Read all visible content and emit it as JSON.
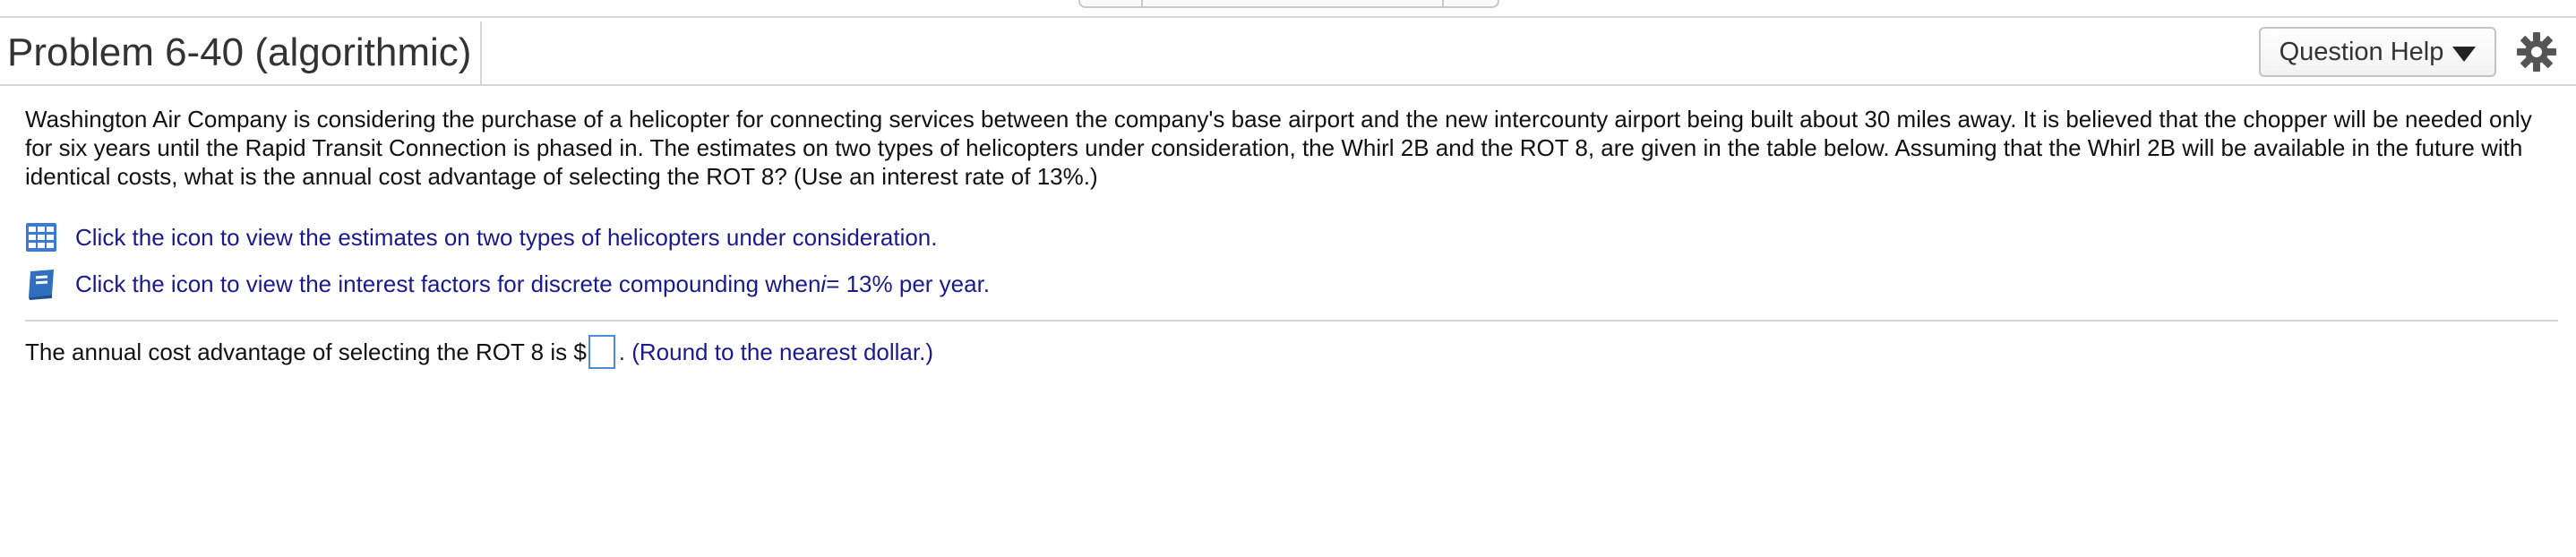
{
  "header": {
    "title": "Problem 6-40 (algorithmic)",
    "help_button_label": "Question Help"
  },
  "problem": {
    "text": "Washington Air Company is considering the purchase of a helicopter for connecting services between the company's base airport and the new intercounty airport being built about 30 miles away. It is believed that the chopper will be needed only for six years until the Rapid Transit Connection is phased in. The estimates on two types of helicopters under consideration, the Whirl 2B and the ROT 8, are given in the table below. Assuming that the Whirl 2B will be available in the future with identical costs, what is the annual cost advantage of selecting the ROT 8? (Use an interest rate of 13%.)"
  },
  "links": {
    "estimates_text": "Click the icon to view the estimates on two types of helicopters under consideration.",
    "interest_text_prefix": "Click the icon to view the interest factors for discrete compounding when ",
    "interest_var": "i",
    "interest_text_suffix": " = 13% per year."
  },
  "answer": {
    "prefix": "The annual cost advantage of selecting the ROT 8 is $",
    "input_value": "",
    "suffix": ". (Round to the nearest dollar.)"
  },
  "colors": {
    "link": "#1a1a8c",
    "table_icon": "#3a7bd5",
    "book_icon": "#2f6fc0",
    "input_border": "#4a8ed4"
  },
  "icons": {
    "table": "table-grid-icon",
    "book": "book-icon",
    "gear": "gear-icon",
    "caret": "caret-down-icon"
  }
}
